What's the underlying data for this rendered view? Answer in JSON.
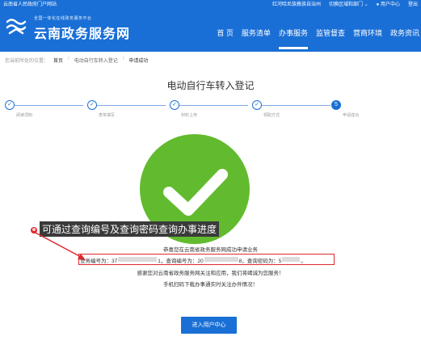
{
  "header": {
    "portal_text": "云南省人民政府门户网站",
    "region_text": "红河哈尼族彝族自治州",
    "switch_text": "切换区域和部门 ⌄",
    "user_center": "用户中心",
    "logout": "登出",
    "logo_subtitle": "全国一体化在线政务服务平台",
    "logo_title": "云南政务服务网",
    "nav": [
      "首 页",
      "服务清单",
      "办事服务",
      "监管督查",
      "营商环境",
      "政务资讯"
    ],
    "active_nav_index": 2,
    "brand_color": "#1a6fd6"
  },
  "breadcrumb": {
    "prefix": "您当前所处的位置：",
    "items": [
      "首页",
      "电动自行车转入登记",
      "申请成功"
    ]
  },
  "page_title": "电动自行车转入登记",
  "steps": [
    {
      "label": "阅读须知",
      "icon": "✓",
      "state": "done"
    },
    {
      "label": "表单填写",
      "icon": "✓",
      "state": "done"
    },
    {
      "label": "材料上传",
      "icon": "✓",
      "state": "done"
    },
    {
      "label": "领取方式",
      "icon": "✓",
      "state": "done"
    },
    {
      "label": "申请成功",
      "icon": "5",
      "state": "current"
    }
  ],
  "success_icon": "check-circle-icon",
  "success_color": "#62bb2e",
  "annotation": {
    "marker": "❶",
    "text": "可通过查询编号及查询密码查询办事进度"
  },
  "messages": {
    "congrats": "恭喜您在云南省政务服务网成功申请业务",
    "business_no_label": "业务编号为：37",
    "business_no_tail": "1，",
    "query_no_label": "查询编号为：20",
    "query_no_tail": "8，",
    "query_pwd_label": "查询密码为：5",
    "query_pwd_tail": "。",
    "thanks": "感谢您对云南省政务服务网关注和应用，我们将竭诚为您服务！",
    "scan": "手机扫码下载办事通实时关注办件情况！"
  },
  "button": {
    "label": "进入用户中心"
  }
}
